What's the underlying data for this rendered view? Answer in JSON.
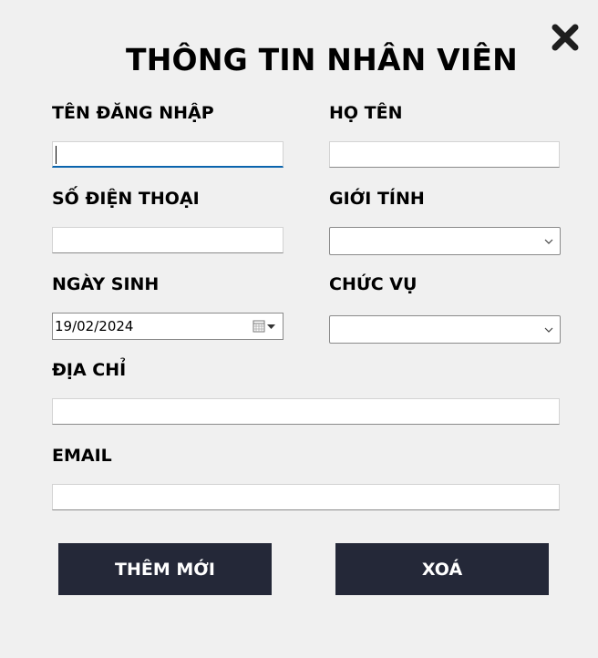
{
  "form": {
    "title": "THÔNG TIN NHÂN VIÊN",
    "close_icon": "close-x-icon",
    "fields": {
      "username": {
        "label": "TÊN ĐĂNG NHẬP",
        "value": ""
      },
      "fullname": {
        "label": "HỌ TÊN",
        "value": ""
      },
      "phone": {
        "label": "SỐ ĐIỆN THOẠI",
        "value": ""
      },
      "gender": {
        "label": "GIỚI TÍNH",
        "value": ""
      },
      "birthdate": {
        "label": "NGÀY SINH",
        "value": "19/02/2024"
      },
      "position": {
        "label": "CHỨC VỤ",
        "value": ""
      },
      "address": {
        "label": "ĐỊA CHỈ",
        "value": ""
      },
      "email": {
        "label": "EMAIL",
        "value": ""
      }
    },
    "buttons": {
      "add": "THÊM MỚI",
      "delete": "XOÁ"
    }
  },
  "colors": {
    "background": "#f0f0f0",
    "button": "#242838",
    "button_text": "#ffffff",
    "focus": "#0a64ad"
  }
}
